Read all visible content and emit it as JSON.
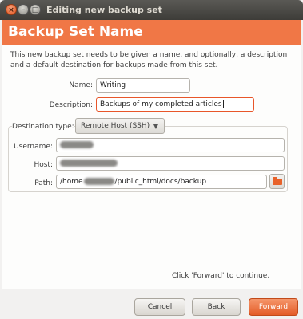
{
  "window": {
    "title": "Editing new backup set"
  },
  "header": {
    "title": "Backup Set Name"
  },
  "intro": "This new backup set needs to be given a name, and optionally, a description and a default destination for backups made from this set.",
  "form": {
    "name_label": "Name:",
    "name_value": "Writing",
    "description_label": "Description:",
    "description_value": "Backups of my completed articles",
    "destination_type_label": "Destination type:",
    "destination_type_value": "Remote Host (SSH)",
    "username_label": "Username:",
    "host_label": "Host:",
    "path_label": "Path:",
    "path_prefix": "/home",
    "path_suffix": "/public_html/docs/backup"
  },
  "hint": "Click 'Forward' to continue.",
  "buttons": {
    "cancel": "Cancel",
    "back": "Back",
    "forward": "Forward"
  },
  "icons": {
    "folder": "folder-icon",
    "close": "close-icon",
    "minimize": "minimize-icon",
    "maximize": "maximize-icon",
    "dropdown": "chevron-down-icon"
  },
  "colors": {
    "accent": "#f07746",
    "titlebar": "#3d3c38"
  }
}
